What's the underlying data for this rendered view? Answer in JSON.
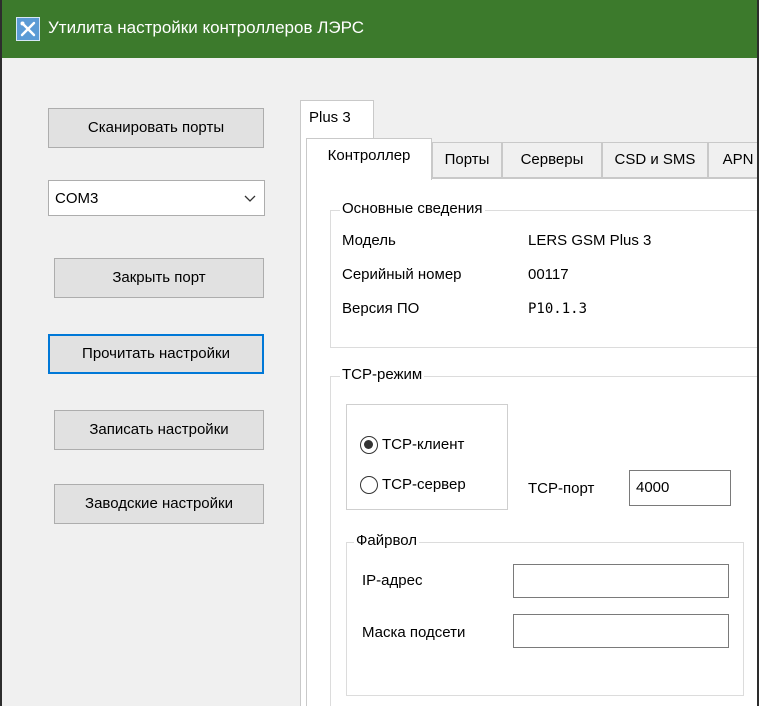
{
  "window": {
    "title": "Утилита настройки контроллеров ЛЭРС",
    "icon": "tools-icon"
  },
  "left_panel": {
    "scan_button": "Сканировать порты",
    "port_select": {
      "value": "COM3"
    },
    "close_port_button": "Закрыть порт",
    "read_settings_button": "Прочитать настройки",
    "write_settings_button": "Записать настройки",
    "factory_settings_button": "Заводские настройки"
  },
  "device_tab": {
    "label": "Plus 3"
  },
  "tabs": [
    {
      "label": "Контроллер",
      "active": true
    },
    {
      "label": "Порты",
      "active": false
    },
    {
      "label": "Серверы",
      "active": false
    },
    {
      "label": "CSD и SMS",
      "active": false
    },
    {
      "label": "APN",
      "active": false
    }
  ],
  "basic_info": {
    "title": "Основные сведения",
    "model_label": "Модель",
    "model_value": "LERS GSM Plus 3",
    "serial_label": "Серийный номер",
    "serial_value": "00117",
    "firmware_label": "Версия ПО",
    "firmware_value": "P10.1.3"
  },
  "tcp_mode": {
    "title": "TCP-режим",
    "client_label": "TCP-клиент",
    "client_selected": true,
    "server_label": "TCP-сервер",
    "server_selected": false,
    "port_label": "TCP-порт",
    "port_value": "4000"
  },
  "firewall": {
    "title": "Файрвол",
    "ip_label": "IP-адрес",
    "ip_value": "",
    "mask_label": "Маска подсети",
    "mask_value": ""
  },
  "colors": {
    "titlebar": "#3c7a2c",
    "focus_border": "#0078d7"
  }
}
